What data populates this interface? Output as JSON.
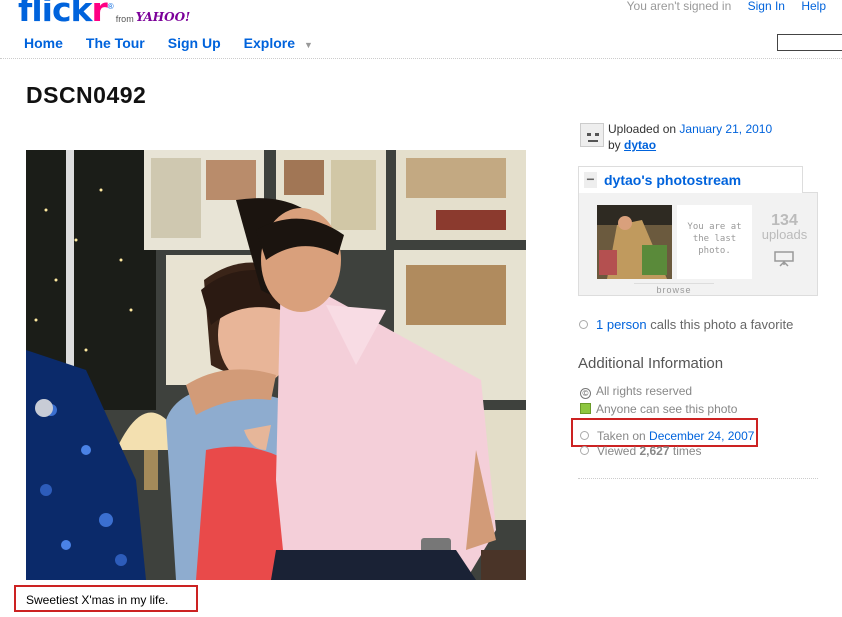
{
  "brand": {
    "logo_part1": "flick",
    "logo_part2": "r",
    "from": "from",
    "yahoo": "YAHOO!"
  },
  "topbar": {
    "signed_out": "You aren't signed in",
    "sign_in": "Sign In",
    "help": "Help"
  },
  "nav": {
    "items": [
      "Home",
      "The Tour",
      "Sign Up",
      "Explore"
    ]
  },
  "photo": {
    "title": "DSCN0492",
    "caption": "Sweetiest X'mas in my life."
  },
  "sidebar": {
    "uploaded_prefix": "Uploaded on",
    "uploaded_date": "January 21, 2010",
    "by": "by",
    "owner": "dytao",
    "photostream": {
      "title": "dytao's photostream",
      "last_line1": "You are at",
      "last_line2": "the last",
      "last_line3": "photo.",
      "count": "134",
      "count_label": "uploads",
      "browse": "browse"
    },
    "fav_link": "1 person",
    "fav_text": "calls this photo a favorite",
    "additional_heading": "Additional Information",
    "rights": "All rights reserved",
    "visibility": "Anyone can see this photo",
    "taken_prefix": "Taken on",
    "taken_date": "December 24, 2007",
    "viewed_prefix": "Viewed",
    "viewed_count": "2,627",
    "viewed_suffix": "times"
  },
  "colors": {
    "link": "#0063dc",
    "brand_pink": "#ff0084",
    "highlight_border": "#cc2222"
  }
}
